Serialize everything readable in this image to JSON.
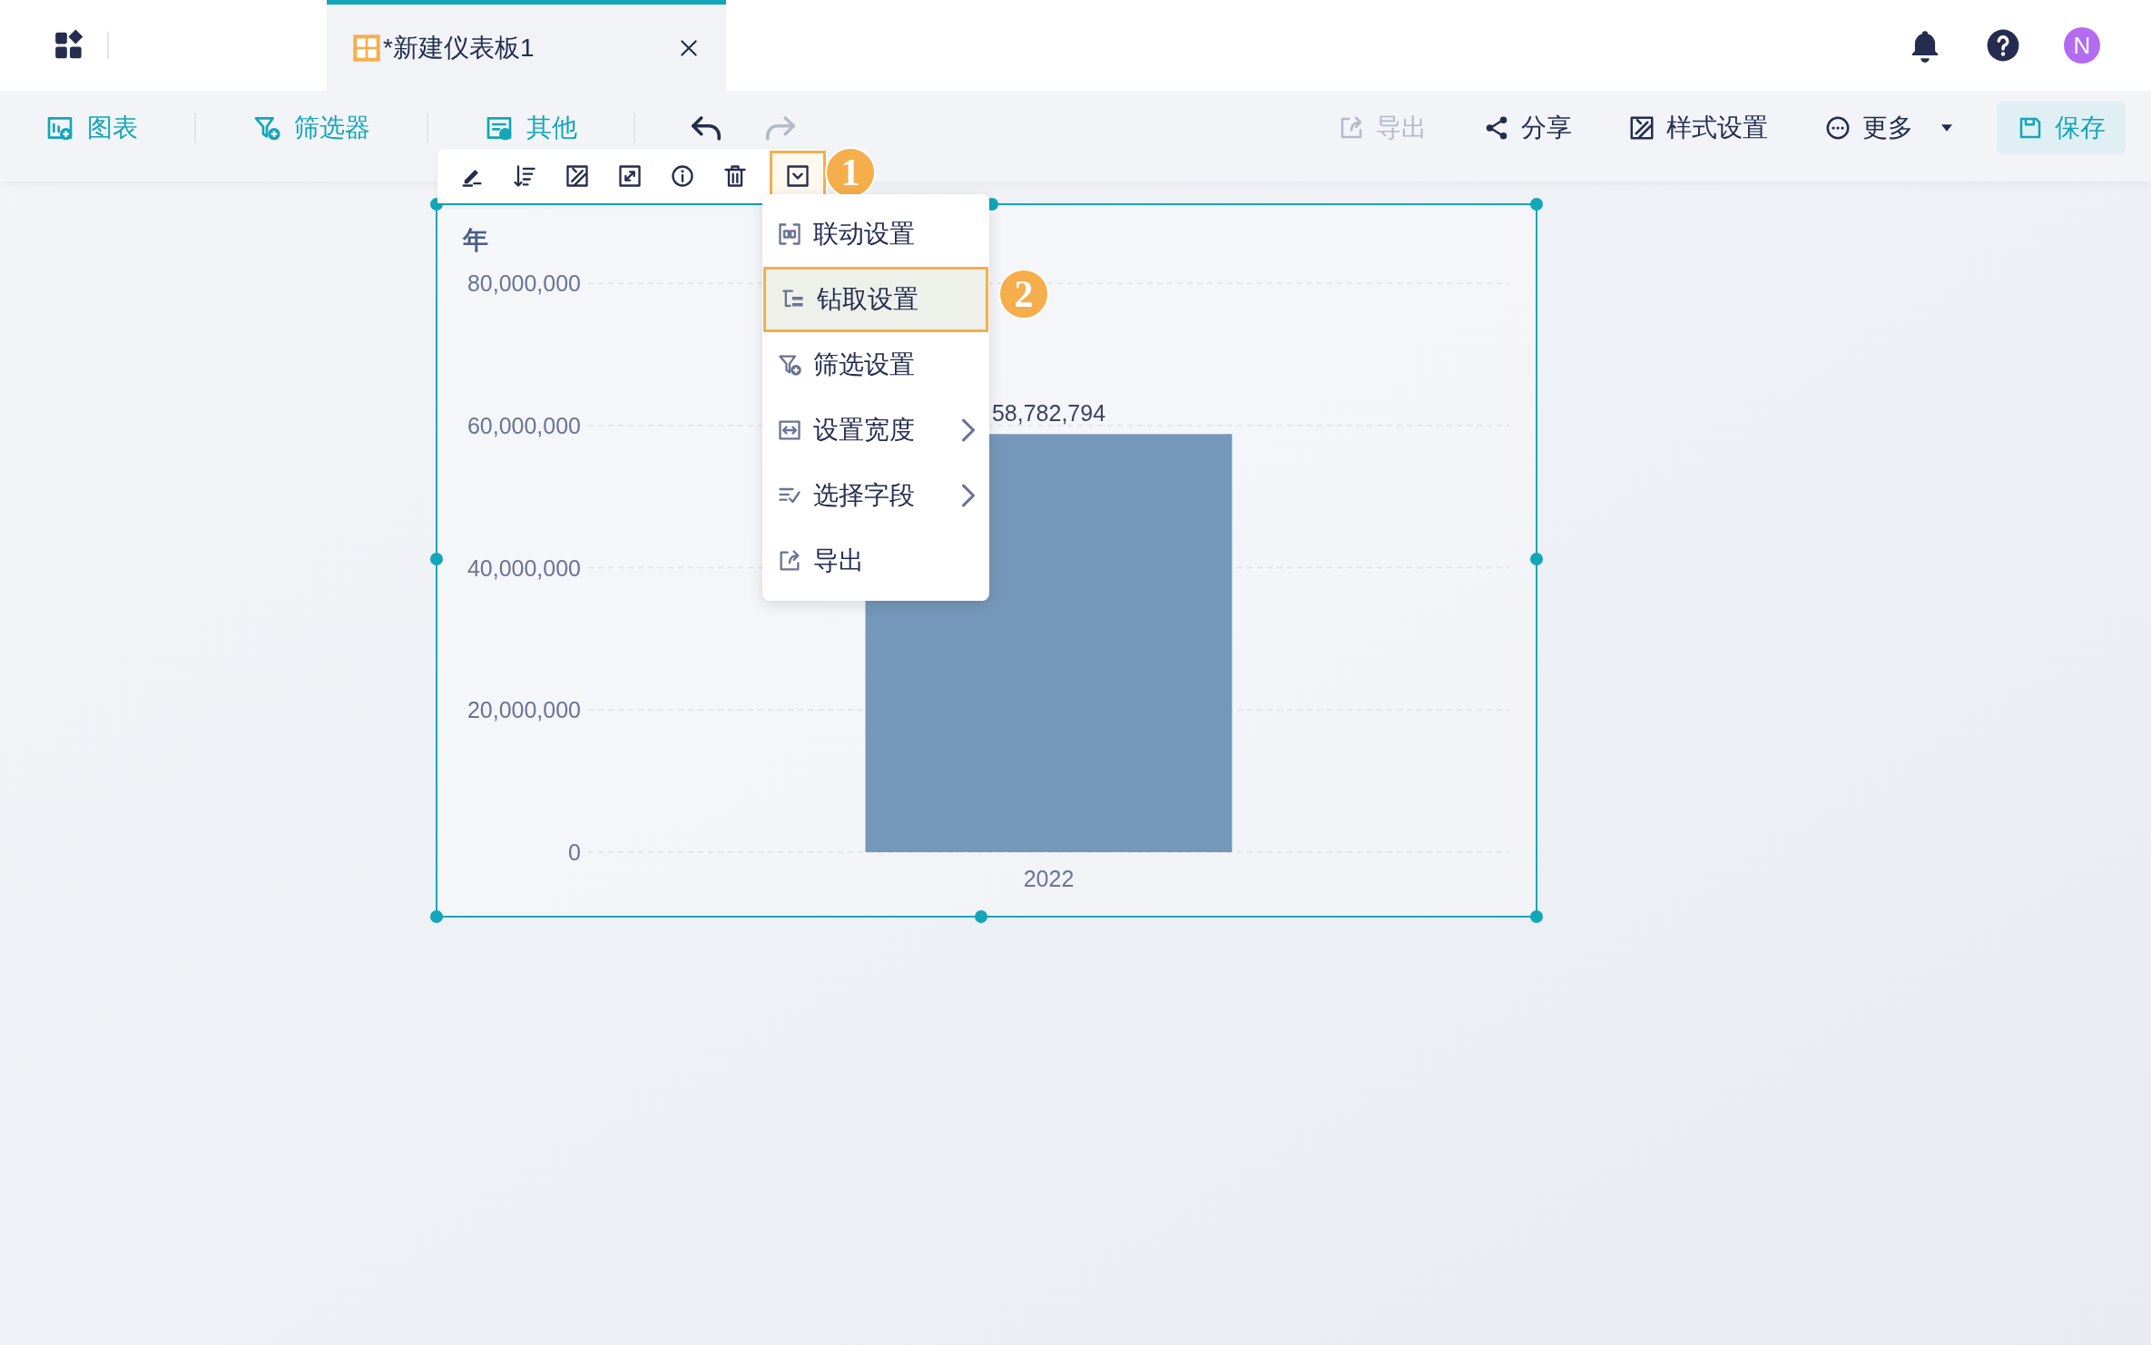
{
  "tab": {
    "title": "*新建仪表板1",
    "selected": true
  },
  "toolbar": {
    "inserts": [
      {
        "kind": "chart",
        "label": "图表"
      },
      {
        "kind": "filter",
        "label": "筛选器"
      },
      {
        "kind": "other",
        "label": "其他"
      }
    ],
    "history": [
      {
        "kind": "undo",
        "disabled": false
      },
      {
        "kind": "redo",
        "disabled": true
      }
    ],
    "actions": [
      {
        "kind": "export",
        "label": "导出",
        "disabled": true
      },
      {
        "kind": "share",
        "label": "分享",
        "disabled": false
      },
      {
        "kind": "style",
        "label": "样式设置",
        "disabled": false
      },
      {
        "kind": "more",
        "label": "更多",
        "disabled": false
      },
      {
        "kind": "save",
        "label": "保存",
        "disabled": false
      }
    ]
  },
  "user": {
    "initial": "N"
  },
  "widget_tools": [
    {
      "kind": "edit",
      "selected": false
    },
    {
      "kind": "sort",
      "selected": false
    },
    {
      "kind": "style",
      "selected": false
    },
    {
      "kind": "expand",
      "selected": false
    },
    {
      "kind": "info",
      "selected": false
    },
    {
      "kind": "delete",
      "selected": false
    },
    {
      "kind": "dropdown",
      "selected": true
    }
  ],
  "chart": {
    "chart_data": {
      "type": "bar",
      "title": "年",
      "categories": [
        "2022"
      ],
      "series": [
        {
          "color": "#7597b9",
          "values": [
            58782794
          ]
        }
      ],
      "ylim": [
        0,
        80000000
      ],
      "grid": true,
      "yticks": [
        {
          "value": 0,
          "label": "0"
        },
        {
          "value": 20000000,
          "label": "20,000,000"
        },
        {
          "value": 40000000,
          "label": "40,000,000"
        },
        {
          "value": 60000000,
          "label": "60,000,000"
        },
        {
          "value": 80000000,
          "label": "80,000,000"
        }
      ],
      "value_labels": [
        "58,782,794"
      ]
    }
  },
  "menu": [
    {
      "kind": "link",
      "label": "联动设置",
      "submenu": false,
      "selected": false
    },
    {
      "kind": "drill",
      "label": "钻取设置",
      "submenu": false,
      "selected": true
    },
    {
      "kind": "filter",
      "label": "筛选设置",
      "submenu": false,
      "selected": false
    },
    {
      "kind": "width",
      "label": "设置宽度",
      "submenu": true,
      "selected": false
    },
    {
      "kind": "fields",
      "label": "选择字段",
      "submenu": true,
      "selected": false
    },
    {
      "kind": "export",
      "label": "导出",
      "submenu": false,
      "selected": false
    }
  ],
  "callouts": [
    "1",
    "2"
  ]
}
